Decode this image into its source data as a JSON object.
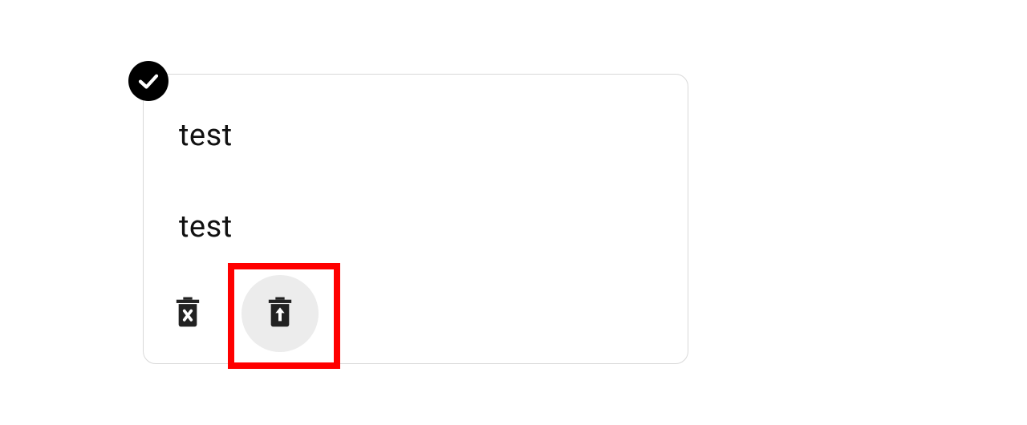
{
  "card": {
    "badge_icon": "check-icon",
    "title": "test",
    "subtitle": "test",
    "actions": {
      "delete_permanent_icon": "trash-x-icon",
      "restore_icon": "trash-restore-icon"
    }
  },
  "highlight": {
    "target": "restore-button",
    "color": "#ff0000"
  }
}
